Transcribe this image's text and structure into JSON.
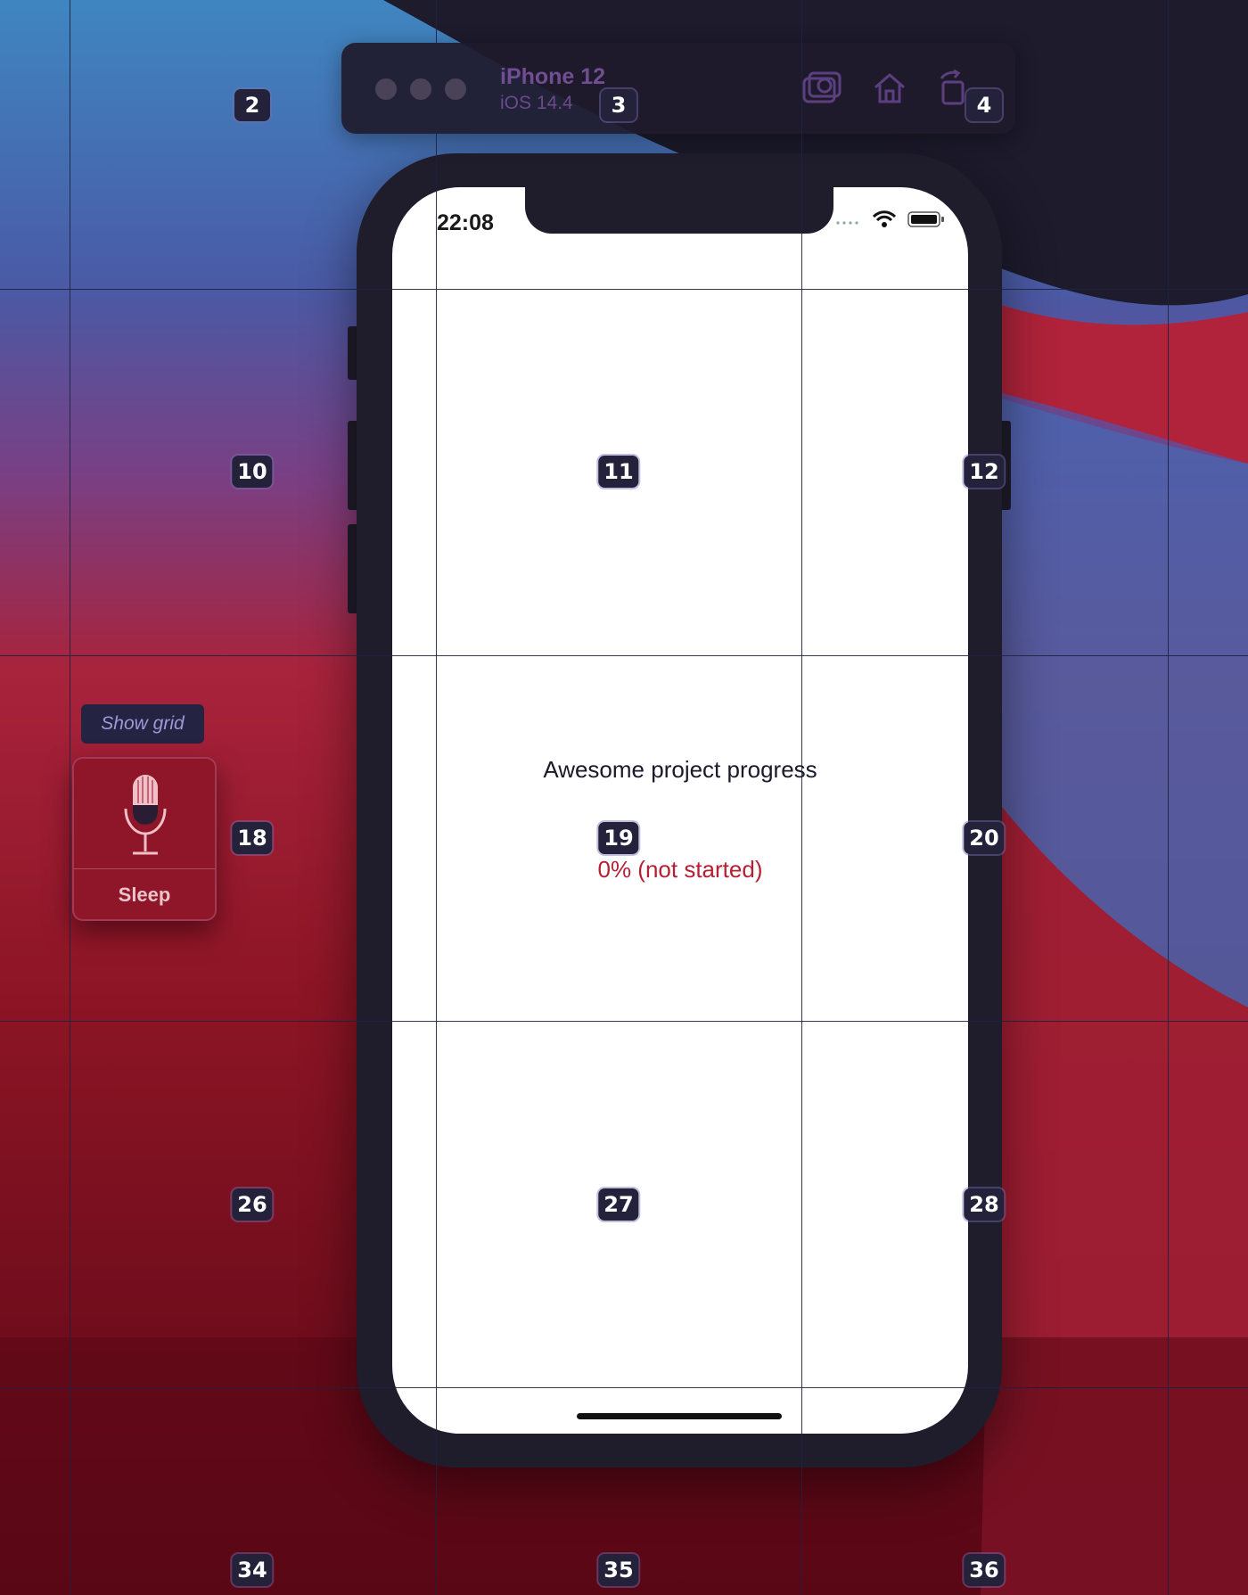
{
  "simulator": {
    "device_name": "iPhone 12",
    "os_version": "iOS 14.4",
    "toolbar_icons": [
      "screenshot-icon",
      "home-icon",
      "rotate-icon"
    ]
  },
  "status_bar": {
    "time": "22:08",
    "icons": [
      "wifi-icon",
      "battery-icon"
    ]
  },
  "app": {
    "title": "Awesome project progress",
    "progress_text": "0% (not started)"
  },
  "side_panel": {
    "show_grid_label": "Show grid",
    "widget_label": "Sleep",
    "widget_icon": "microphone-icon"
  },
  "grid": {
    "labels": [
      "2",
      "3",
      "4",
      "10",
      "11",
      "12",
      "18",
      "19",
      "20",
      "26",
      "27",
      "28",
      "34",
      "35",
      "36"
    ]
  },
  "colors": {
    "progress_text": "#b52133",
    "toolbar_text": "#6f4e92",
    "grid_label_bg": "#24223a"
  }
}
